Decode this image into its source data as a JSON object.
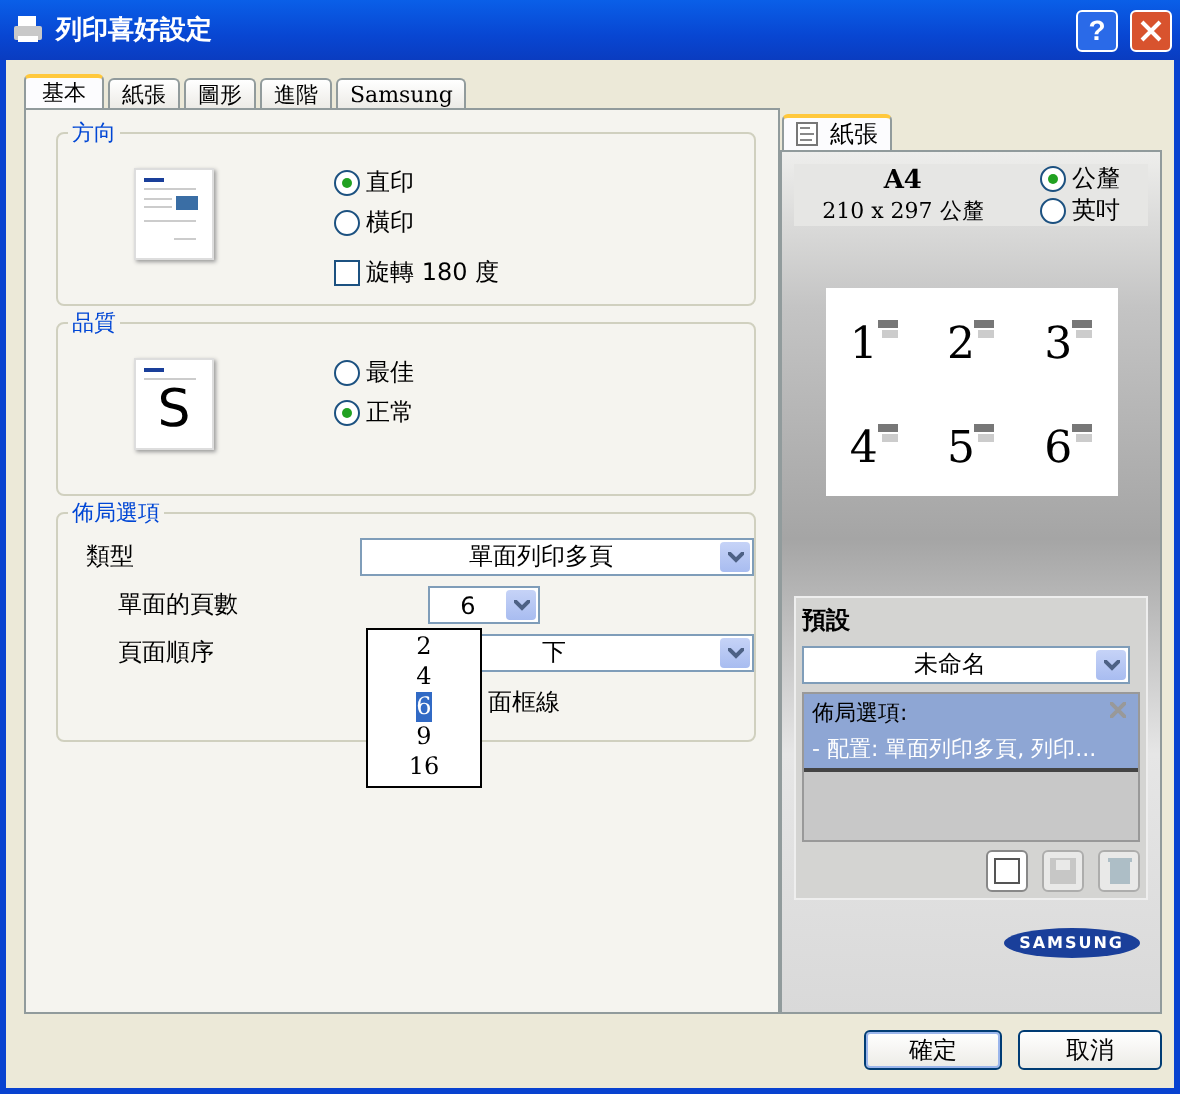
{
  "window": {
    "title": "列印喜好設定",
    "help": "?"
  },
  "tabs": [
    {
      "label": "基本",
      "selected": true
    },
    {
      "label": "紙張",
      "selected": false
    },
    {
      "label": "圖形",
      "selected": false
    },
    {
      "label": "進階",
      "selected": false
    },
    {
      "label": "Samsung",
      "selected": false
    }
  ],
  "orientation": {
    "title": "方向",
    "options": [
      {
        "kind": "radio",
        "label": "直印",
        "selected": true
      },
      {
        "kind": "radio",
        "label": "橫印",
        "selected": false
      },
      {
        "kind": "checkbox",
        "label": "旋轉 180 度",
        "checked": false
      }
    ]
  },
  "quality": {
    "title": "品質",
    "preview_letter": "S",
    "options": [
      {
        "label": "最佳",
        "selected": false
      },
      {
        "label": "正常",
        "selected": true
      }
    ]
  },
  "layout": {
    "title": "佈局選項",
    "type": {
      "label": "類型",
      "value": "單面列印多頁"
    },
    "pages_per_side": {
      "label": "單面的頁數",
      "value": "6",
      "expanded": true,
      "options": [
        {
          "label": "2",
          "selected": false
        },
        {
          "label": "4",
          "selected": false
        },
        {
          "label": "6",
          "selected": true
        },
        {
          "label": "9",
          "selected": false
        },
        {
          "label": "16",
          "selected": false
        }
      ]
    },
    "page_order": {
      "label": "頁面順序",
      "value": "下"
    },
    "border": {
      "label": "面框線"
    }
  },
  "paper_tab": {
    "label": "紙張"
  },
  "paper": {
    "size": "A4",
    "dimensions": "210 x 297 公釐",
    "units": [
      {
        "label": "公釐",
        "selected": true
      },
      {
        "label": "英吋",
        "selected": false
      }
    ],
    "preview_pages": [
      "1",
      "2",
      "3",
      "4",
      "5",
      "6"
    ]
  },
  "presets": {
    "title": "預設",
    "value": "未命名",
    "items": [
      {
        "title": "佈局選項:",
        "detail": "- 配置: 單面列印多頁, 列印...",
        "selected": true
      }
    ]
  },
  "logo": "SAMSUNG",
  "buttons": [
    "確定",
    "取消"
  ]
}
